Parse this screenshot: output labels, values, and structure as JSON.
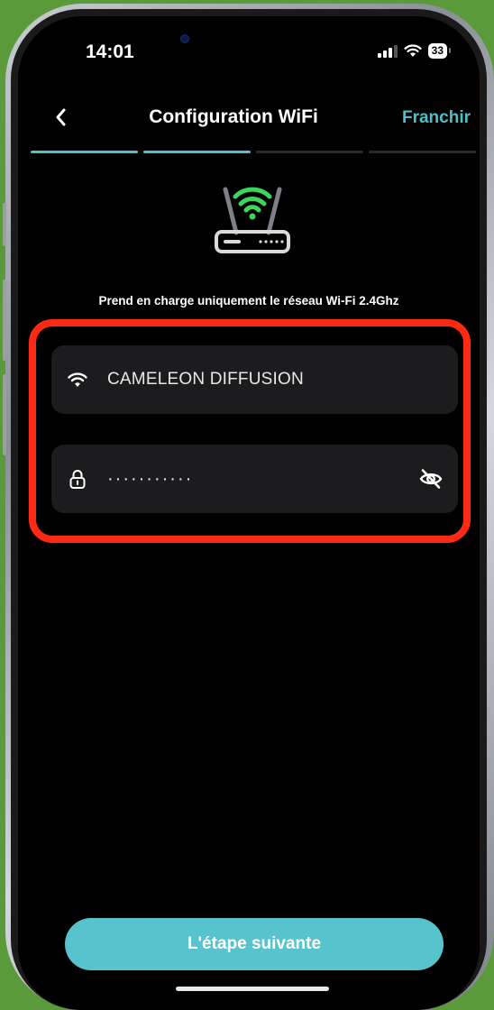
{
  "status": {
    "time": "14:01",
    "battery": "33"
  },
  "nav": {
    "back_icon": "chevron-left-icon",
    "title": "Configuration WiFi",
    "skip_label": "Franchir"
  },
  "progress": {
    "total_steps": 4,
    "completed_steps": 2
  },
  "illustration": {
    "icon": "router-wifi-icon",
    "accent": "#3dd65c"
  },
  "support_text": "Prend en charge uniquement le réseau Wi-Fi 2.4Ghz",
  "form": {
    "ssid": {
      "icon": "wifi-icon",
      "value": "CAMELEON DIFFUSION"
    },
    "password": {
      "icon": "lock-icon",
      "value": "···········",
      "toggle_icon": "eye-off-icon"
    }
  },
  "next_button": {
    "label": "L'étape suivante"
  },
  "colors": {
    "accent": "#4fbfc8",
    "button": "#57c4cd",
    "highlight": "#ff2a14",
    "field_bg": "#1c1c1e"
  }
}
